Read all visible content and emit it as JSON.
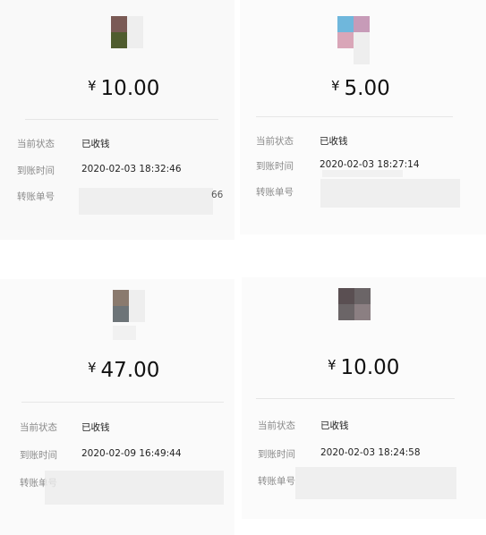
{
  "receipts": [
    {
      "currency_symbol": "¥",
      "amount": "10.00",
      "status_label": "当前状态",
      "status_value": "已收钱",
      "time_label": "到账时间",
      "time_value": "2020-02-03 18:32:46",
      "order_label": "转账单号",
      "order_value_partial": "66",
      "avatar_colors": [
        "#7a5a55",
        "#4f5c2e"
      ]
    },
    {
      "currency_symbol": "¥",
      "amount": "5.00",
      "status_label": "当前状态",
      "status_value": "已收钱",
      "time_label": "到账时间",
      "time_value": "2020-02-03 18:27:14",
      "order_label": "转账单号",
      "avatar_colors": [
        "#6fb7dc",
        "#c79bb8",
        "#d9a6b8"
      ]
    },
    {
      "currency_symbol": "¥",
      "amount": "47.00",
      "status_label": "当前状态",
      "status_value": "已收钱",
      "time_label": "到账时间",
      "time_value": "2020-02-09 16:49:44",
      "order_label": "转账单号",
      "avatar_colors": [
        "#8a7a6e",
        "#6d7478"
      ]
    },
    {
      "currency_symbol": "¥",
      "amount": "10.00",
      "status_label": "当前状态",
      "status_value": "已收钱",
      "time_label": "到账时间",
      "time_value": "2020-02-03 18:24:58",
      "order_label": "转账单号",
      "avatar_colors": [
        "#5a4f52",
        "#8b7f82",
        "#6b6567"
      ]
    }
  ]
}
